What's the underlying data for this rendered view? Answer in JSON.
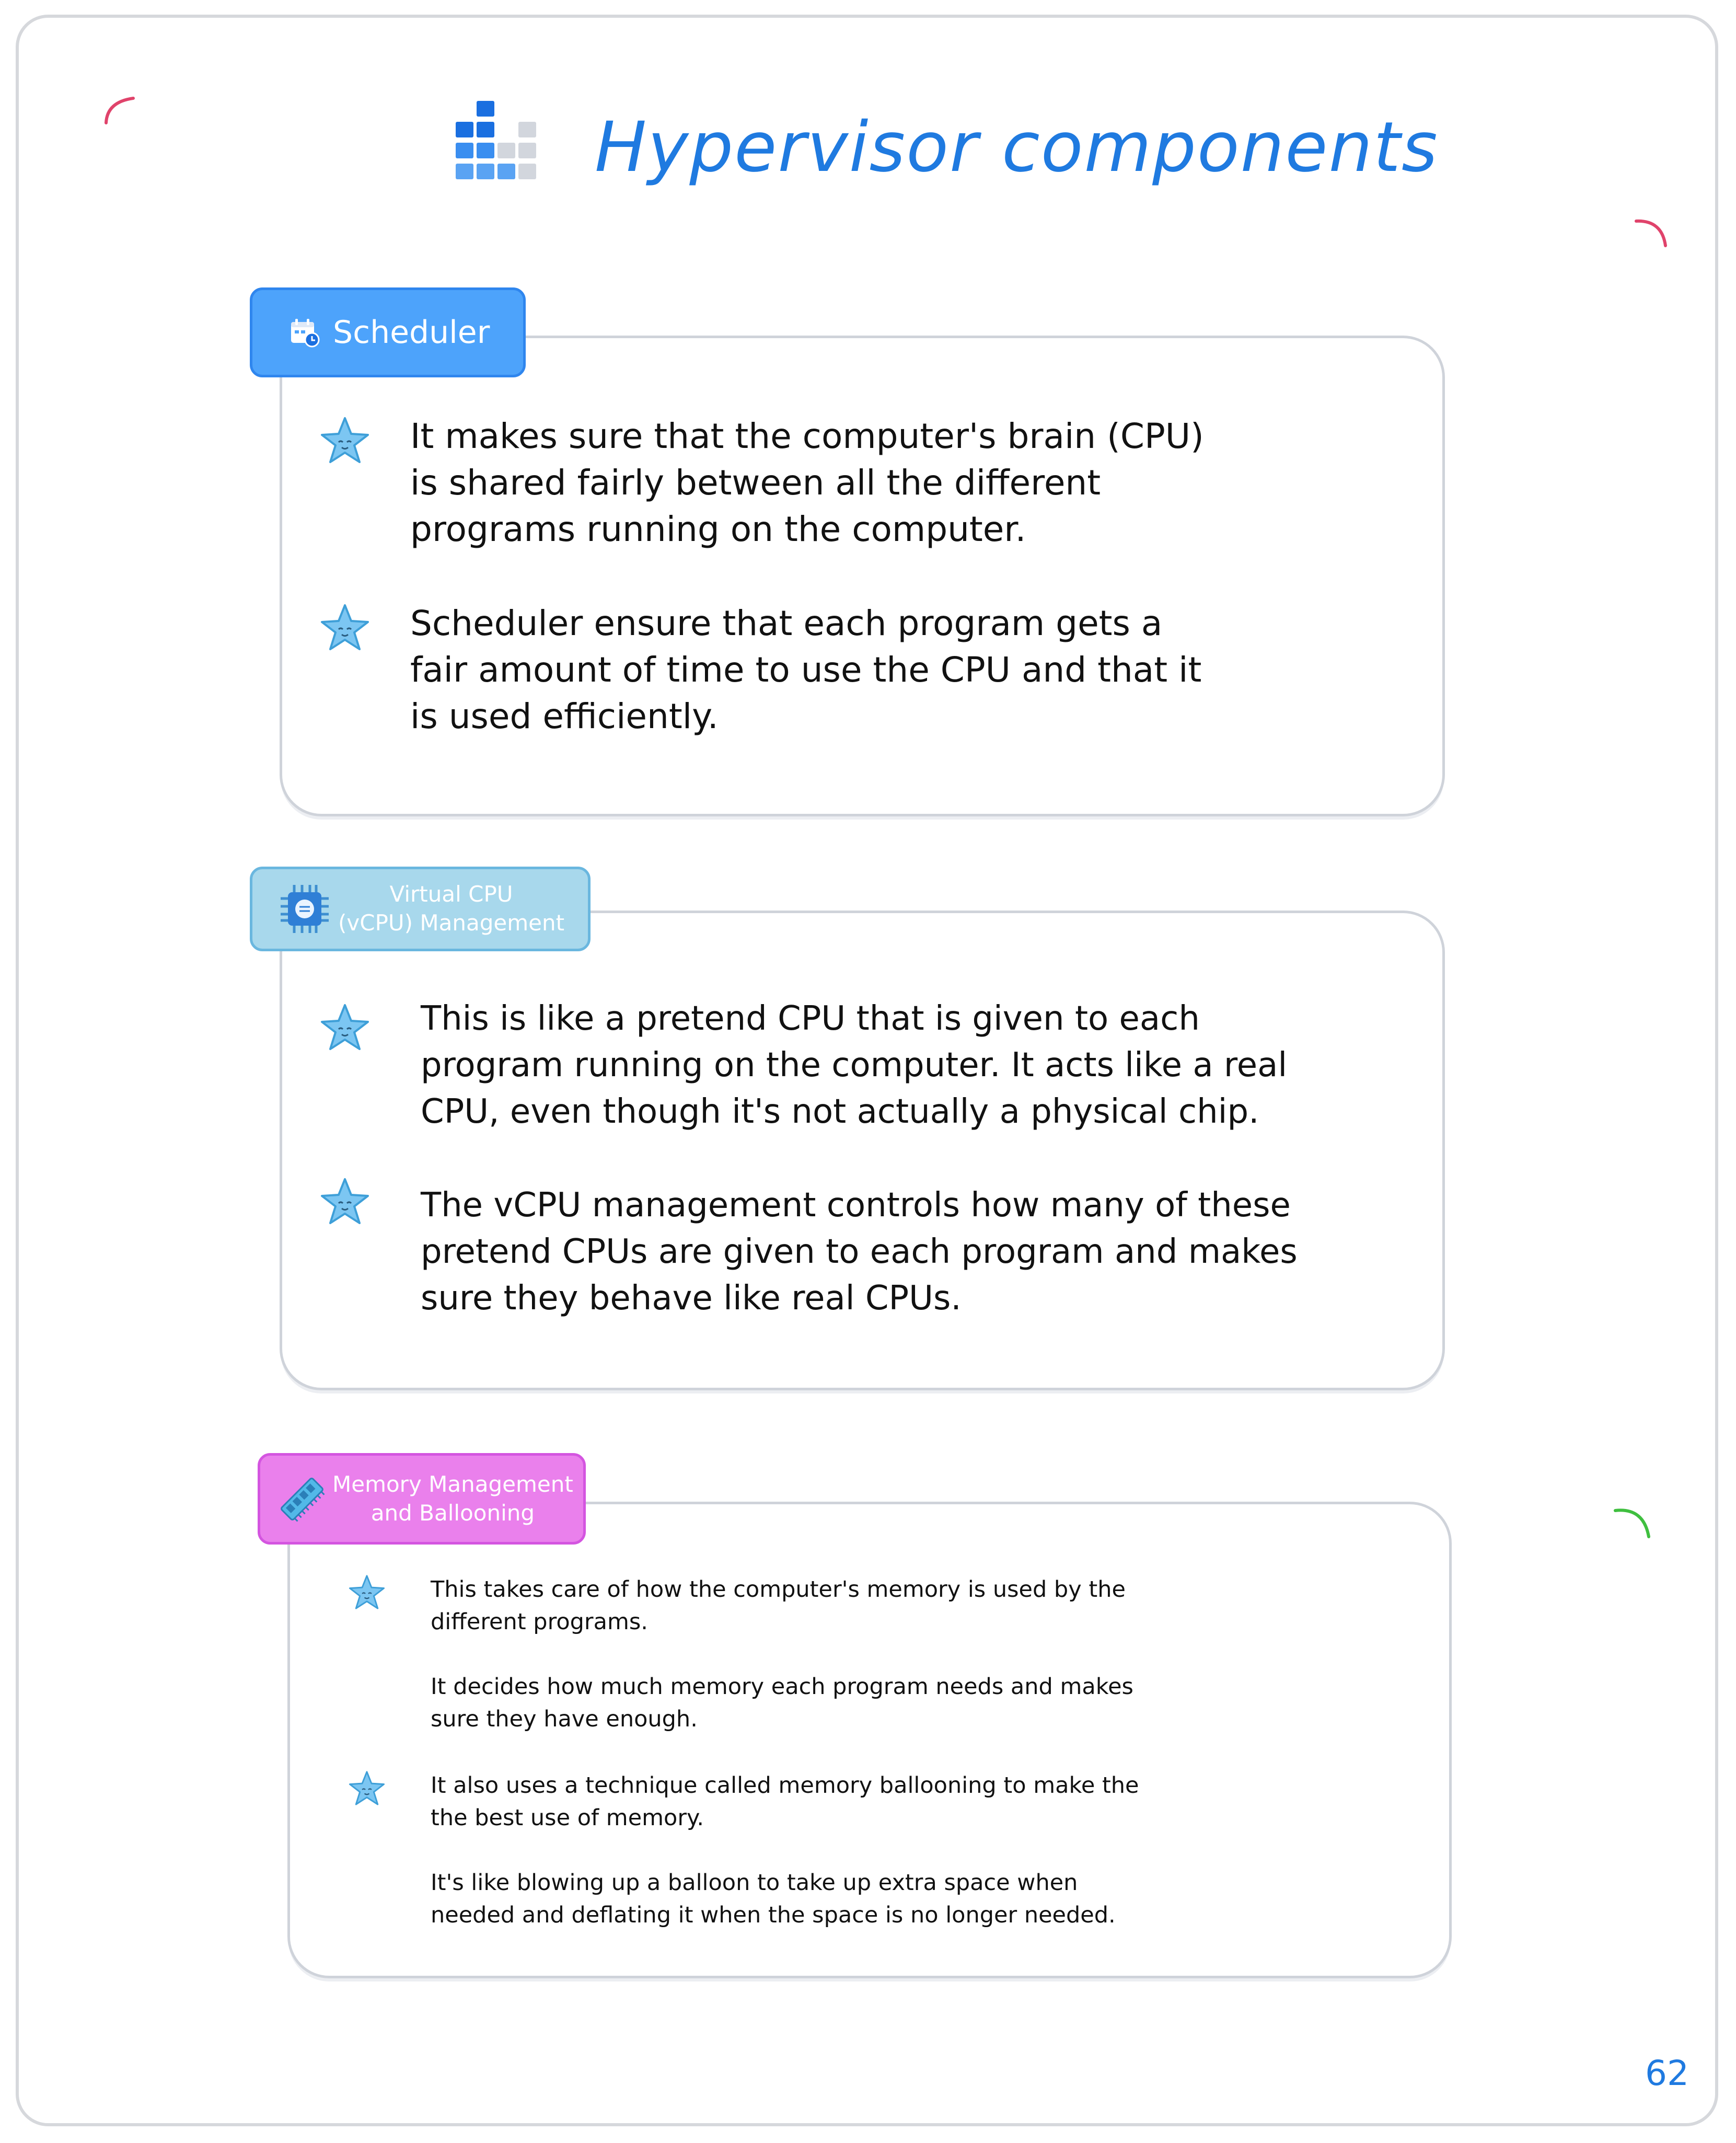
{
  "header": {
    "title": "Hypervisor components",
    "logo_icon": "bar-blocks-icon"
  },
  "sections": [
    {
      "tab_label": "Scheduler",
      "tab_icon": "calendar-clock-icon",
      "tab_color": "#4da3fb",
      "paragraphs": [
        [
          "It makes sure that the computer's brain (CPU)",
          "is shared fairly between all the different",
          "programs running on the computer."
        ],
        [
          "Scheduler ensure that each program gets a",
          "fair amount of time to use the CPU and that it",
          "is used efficiently."
        ]
      ]
    },
    {
      "tab_label_lines": [
        "Virtual CPU",
        "(vCPU) Management"
      ],
      "tab_icon": "cpu-chip-icon",
      "tab_color": "#a8d8ec",
      "paragraphs": [
        [
          "This is like a pretend CPU that is given to each",
          "program running on the computer. It acts like a real",
          "CPU, even though it's not actually a physical chip."
        ],
        [
          "The vCPU management controls how many of these",
          "pretend CPUs are given to each program and makes",
          "sure they behave like real CPUs."
        ]
      ]
    },
    {
      "tab_label_lines": [
        "Memory Management",
        "and Ballooning"
      ],
      "tab_icon": "memory-module-icon",
      "tab_color": "#ea80ec",
      "paragraphs": [
        [
          "This takes care of how the computer's memory is used by the",
          "different programs."
        ],
        [
          "It decides how much memory each program needs and makes",
          "sure they have enough."
        ],
        [
          "It also uses a technique called memory ballooning to make the",
          "the best use of memory."
        ],
        [
          "It's like blowing up a balloon to take up extra space when",
          "needed and deflating it when the space is no longer needed."
        ]
      ]
    }
  ],
  "page_number": "62",
  "colors": {
    "accent": "#1f7ae0",
    "star": "#7cc6f2",
    "frame": "#d6d8dc"
  }
}
